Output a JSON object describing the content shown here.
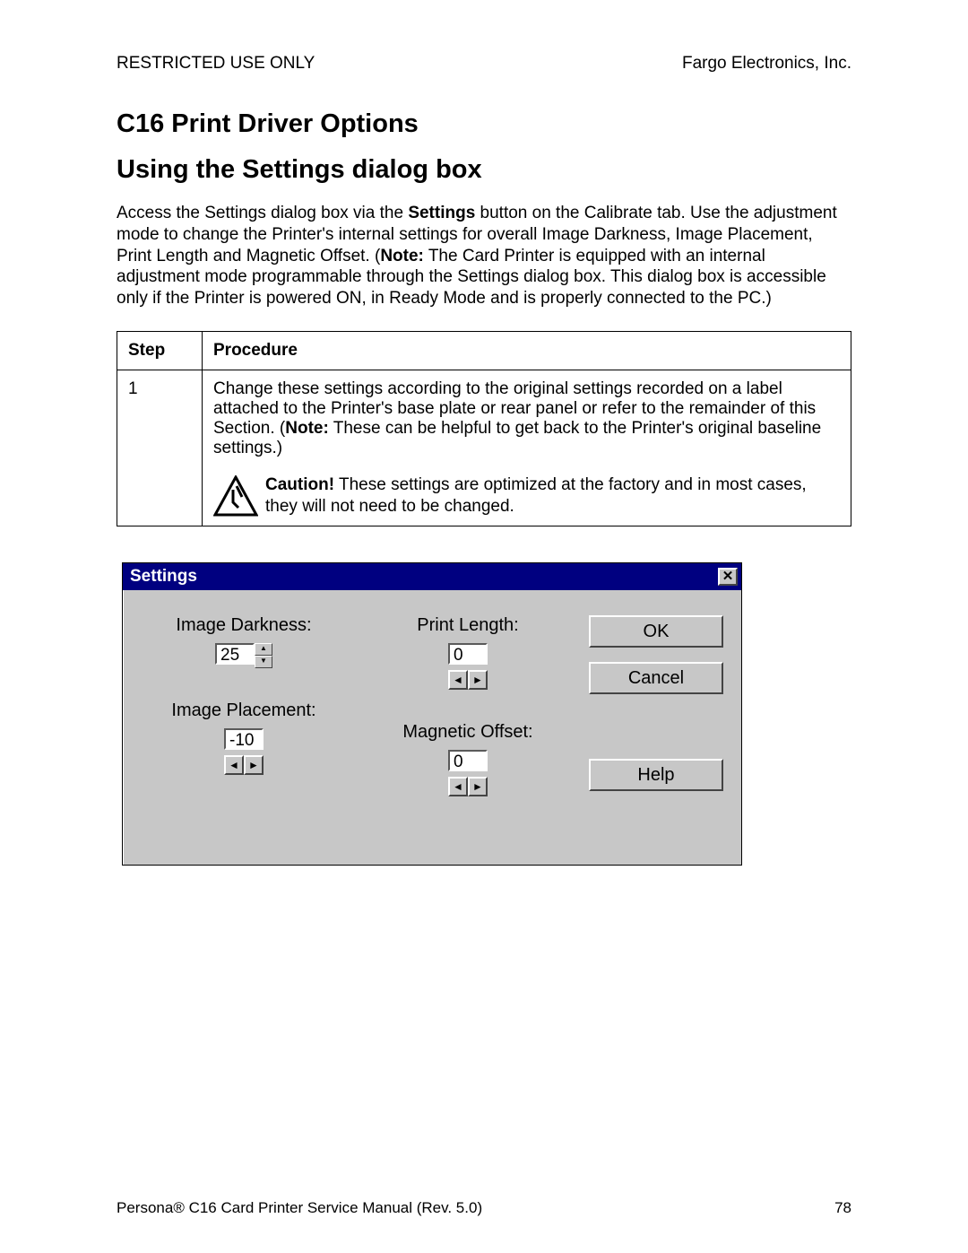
{
  "header": {
    "left": "RESTRICTED USE ONLY",
    "right": "Fargo Electronics, Inc."
  },
  "headings": {
    "h1": "C16 Print Driver Options",
    "h2": "Using the Settings dialog box"
  },
  "intro": {
    "part1": "Access the Settings dialog box via the ",
    "settings_bold": "Settings",
    "part2": " button on the Calibrate tab. Use the adjustment mode to change the Printer's internal settings for overall Image Darkness, Image Placement, Print Length and Magnetic Offset. (",
    "note_bold": "Note:",
    "part3": "  The Card Printer is equipped with an internal adjustment mode programmable through the Settings dialog box. This dialog box is accessible only if the Printer is powered ON, in Ready Mode and is properly connected to the PC.)"
  },
  "table": {
    "col_step": "Step",
    "col_proc": "Procedure",
    "row1": {
      "step": "1",
      "text1": "Change these settings according to the original settings recorded on a label attached to the Printer's base plate or rear panel or refer to the remainder of this Section. (",
      "note_bold": "Note:",
      "text2": "  These can be helpful to get back to the Printer's original baseline settings.)",
      "caution_bold": "Caution!",
      "caution_text": "  These settings are optimized at the factory and in most cases, they will not need to be changed."
    }
  },
  "dialog": {
    "title": "Settings",
    "close_glyph": "✕",
    "fields": {
      "image_darkness": {
        "label": "Image Darkness:",
        "value": "25"
      },
      "image_placement": {
        "label": "Image Placement:",
        "value": "-10"
      },
      "print_length": {
        "label": "Print Length:",
        "value": "0"
      },
      "magnetic_offset": {
        "label": "Magnetic Offset:",
        "value": "0"
      }
    },
    "buttons": {
      "ok": "OK",
      "cancel": "Cancel",
      "help": "Help"
    },
    "arrows": {
      "up": "▲",
      "down": "▼",
      "left": "◄",
      "right": "►"
    }
  },
  "footer": {
    "left": "Persona® C16 Card Printer Service Manual (Rev. 5.0)",
    "right": "78"
  }
}
